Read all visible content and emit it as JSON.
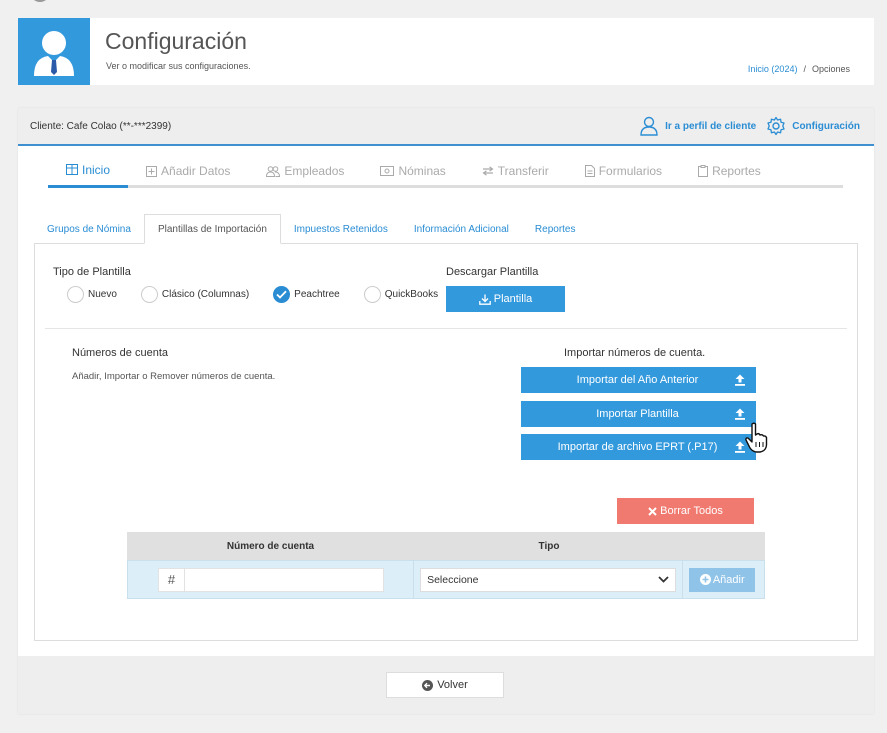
{
  "header": {
    "title": "Configuración",
    "subtitle": "Ver o modificar sus configuraciones.",
    "breadcrumb": {
      "home": "Inicio (2024)",
      "separator": "/",
      "current": "Opciones"
    }
  },
  "client_bar": {
    "client": "Cliente: Cafe Colao (**-***2399)",
    "profile_link": "Ir a perfil de cliente",
    "config_link": "Configuración"
  },
  "main_tabs": [
    {
      "label": "Inicio",
      "active": true
    },
    {
      "label": "Añadir Datos"
    },
    {
      "label": "Empleados"
    },
    {
      "label": "Nóminas"
    },
    {
      "label": "Transferir"
    },
    {
      "label": "Formularios"
    },
    {
      "label": "Reportes"
    }
  ],
  "sub_tabs": [
    {
      "label": "Grupos de Nómina"
    },
    {
      "label": "Plantillas de Importación",
      "active": true
    },
    {
      "label": "Impuestos Retenidos"
    },
    {
      "label": "Información Adicional"
    },
    {
      "label": "Reportes"
    }
  ],
  "template": {
    "tipo_label": "Tipo de Plantilla",
    "options": [
      {
        "label": "Nuevo",
        "checked": false
      },
      {
        "label": "Clásico (Columnas)",
        "checked": false
      },
      {
        "label": "Peachtree",
        "checked": true
      },
      {
        "label": "QuickBooks",
        "checked": false
      }
    ],
    "descargar_label": "Descargar Plantilla",
    "descargar_button": "Plantilla"
  },
  "cuentas": {
    "title": "Números de cuenta",
    "description": "Añadir, Importar o Remover números de cuenta.",
    "import_title": "Importar números de cuenta.",
    "import_buttons": [
      "Importar del Año Anterior",
      "Importar Plantilla",
      "Importar de archivo EPRT (.P17)"
    ],
    "borrar_button": "Borrar Todos"
  },
  "table": {
    "col_numero": "Número de cuenta",
    "col_tipo": "Tipo",
    "hash": "#",
    "account_value": "",
    "select_value": "Seleccione",
    "add_button": "Añadir"
  },
  "footer": {
    "back_button": "Volver"
  },
  "colors": {
    "accent": "#3399dd",
    "danger": "#f07a70",
    "muted_tab": "#aaaaaa"
  }
}
